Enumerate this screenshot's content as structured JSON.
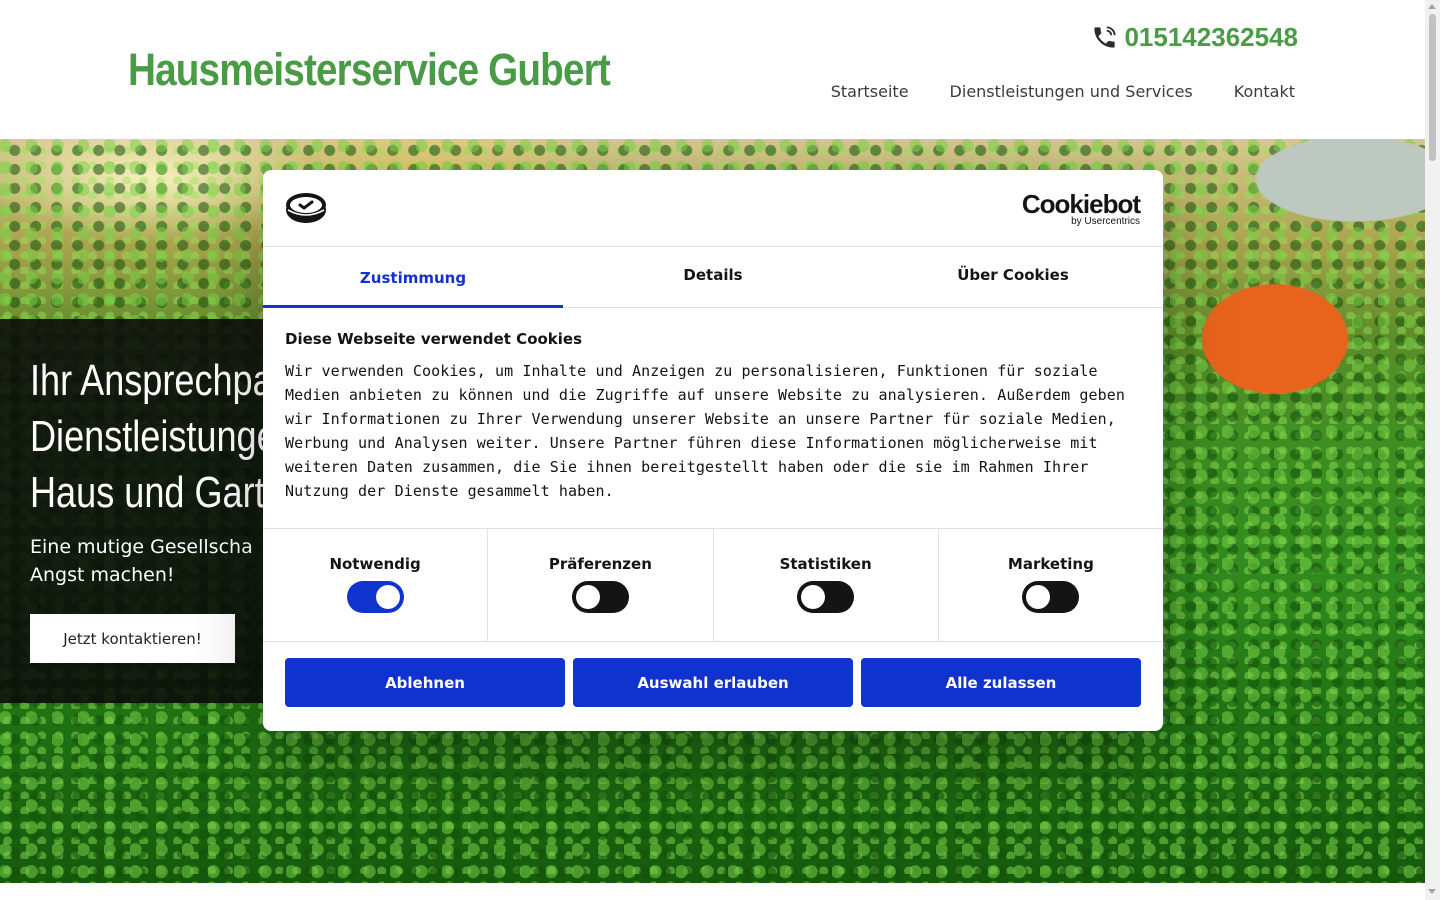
{
  "header": {
    "site_title": "Hausmeisterservice Gubert",
    "phone": "015142362548",
    "phone_icon": "phone-icon",
    "nav": [
      {
        "label": "Startseite"
      },
      {
        "label": "Dienstleistungen und Services"
      },
      {
        "label": "Kontakt"
      }
    ]
  },
  "hero": {
    "title_lines": [
      "Ihr Ansprechpa",
      "Dienstleistunge",
      "Haus und Garte"
    ],
    "subtitle_lines": [
      "Eine mutige Gesellscha",
      "Angst machen!"
    ],
    "cta": "Jetzt kontaktieren!"
  },
  "cookie_dialog": {
    "brand": "Cookiebot",
    "brand_sub": "by Usercentrics",
    "tabs": [
      {
        "label": "Zustimmung",
        "active": true
      },
      {
        "label": "Details",
        "active": false
      },
      {
        "label": "Über Cookies",
        "active": false
      }
    ],
    "heading": "Diese Webseite verwendet Cookies",
    "text": "Wir verwenden Cookies, um Inhalte und Anzeigen zu personalisieren, Funktionen für soziale Medien anbieten zu können und die Zugriffe auf unsere Website zu analysieren. Außerdem geben wir Informationen zu Ihrer Verwendung unserer Website an unsere Partner für soziale Medien, Werbung und Analysen weiter. Unsere Partner führen diese Informationen möglicherweise mit weiteren Daten zusammen, die Sie ihnen bereitgestellt haben oder die sie im Rahmen Ihrer Nutzung der Dienste gesammelt haben.",
    "toggles": [
      {
        "label": "Notwendig",
        "on": true
      },
      {
        "label": "Präferenzen",
        "on": false
      },
      {
        "label": "Statistiken",
        "on": false
      },
      {
        "label": "Marketing",
        "on": false
      }
    ],
    "buttons": {
      "decline": "Ablehnen",
      "allow_selection": "Auswahl erlauben",
      "allow_all": "Alle zulassen"
    }
  },
  "colors": {
    "brand_green": "#4a9b46",
    "cookiebot_blue": "#1032cf"
  }
}
